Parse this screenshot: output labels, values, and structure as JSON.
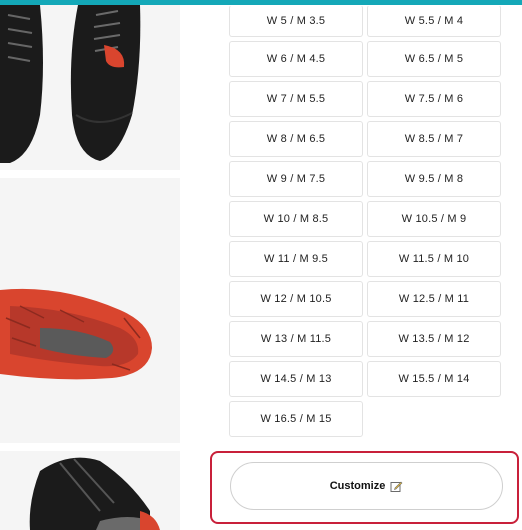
{
  "sizes": [
    "W 5 / M 3.5",
    "W 5.5 / M 4",
    "W 6 / M 4.5",
    "W 6.5 / M 5",
    "W 7 / M 5.5",
    "W 7.5 / M 6",
    "W 8 / M 6.5",
    "W 8.5 / M 7",
    "W 9 / M 7.5",
    "W 9.5 / M 8",
    "W 10 / M 8.5",
    "W 10.5 / M 9",
    "W 11 / M 9.5",
    "W 11.5 / M 10",
    "W 12 / M 10.5",
    "W 12.5 / M 11",
    "W 13 / M 11.5",
    "W 13.5 / M 12",
    "W 14.5 / M 13",
    "W 15.5 / M 14",
    "W 16.5 / M 15"
  ],
  "customize": {
    "label": "Customize",
    "icon": "edit-icon"
  },
  "colors": {
    "accent_bar": "#14a8b8",
    "highlight": "#c8203a",
    "shoe_upper": "#1b1b1b",
    "shoe_sole": "#d9452e"
  }
}
